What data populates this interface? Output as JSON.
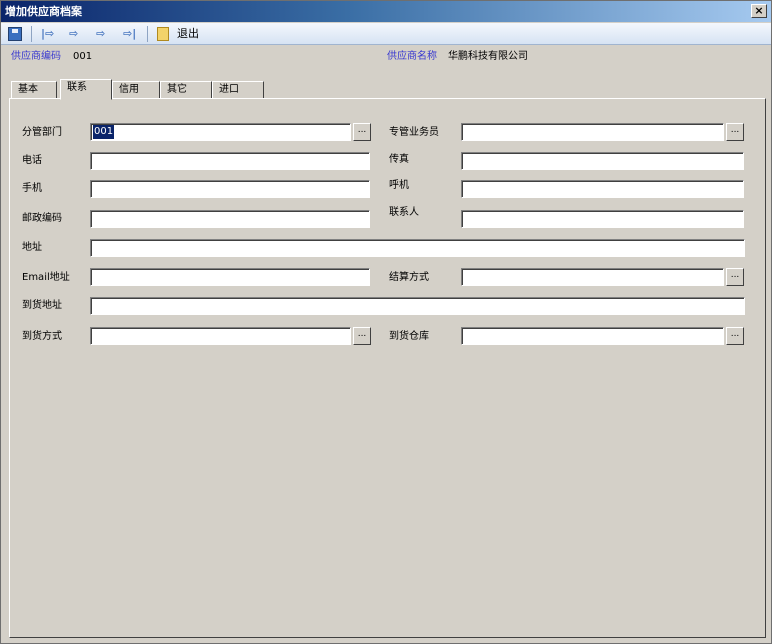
{
  "window": {
    "title": "增加供应商档案",
    "close_glyph": "×"
  },
  "toolbar": {
    "save_icon": "save-icon",
    "nav_first": "|⇨",
    "nav_prev": "⇨",
    "nav_next": "⇨",
    "nav_last": "⇨|",
    "exit_icon": "exit-icon",
    "exit_label": "退出"
  },
  "info": {
    "code_label": "供应商编码",
    "code_value": "001",
    "name_label": "供应商名称",
    "name_value": "华鹏科技有限公司"
  },
  "tabs": [
    {
      "label": "基本"
    },
    {
      "label": "联系",
      "active": true
    },
    {
      "label": "信用"
    },
    {
      "label": "其它"
    },
    {
      "label": "进口"
    }
  ],
  "form": {
    "dept_label": "分管部门",
    "dept_value": "001",
    "salesman_label": "专管业务员",
    "phone_label": "电话",
    "fax_label": "传真",
    "mobile_label": "手机",
    "pager_label": "呼机",
    "postcode_label": "邮政编码",
    "contact_label": "联系人",
    "address_label": "地址",
    "email_label": "Email地址",
    "settle_label": "结算方式",
    "delivery_addr_label": "到货地址",
    "delivery_method_label": "到货方式",
    "warehouse_label": "到货仓库",
    "ellipsis": "..."
  }
}
